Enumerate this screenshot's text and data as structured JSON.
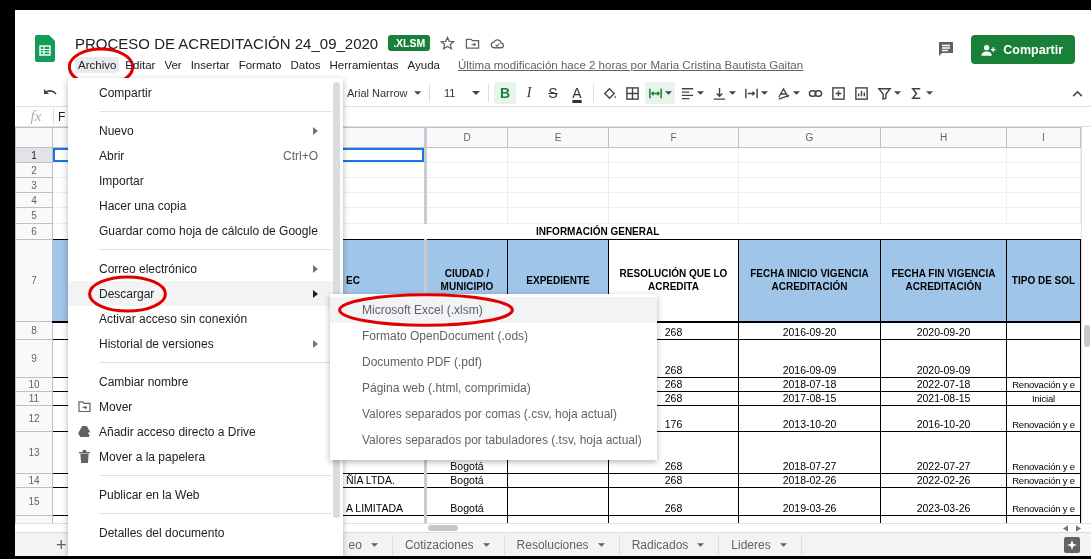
{
  "app": {
    "title": "PROCESO DE ACREDITACIÓN 24_09_2020",
    "badge": ".XLSM",
    "menus": [
      {
        "label": "Archivo",
        "selected": true,
        "circled": true
      },
      {
        "label": "Editar",
        "selected": false,
        "circled": false
      },
      {
        "label": "Ver",
        "selected": false,
        "circled": false
      },
      {
        "label": "Insertar",
        "selected": false,
        "circled": false
      },
      {
        "label": "Formato",
        "selected": false,
        "circled": false
      },
      {
        "label": "Datos",
        "selected": false,
        "circled": false
      },
      {
        "label": "Herramientas",
        "selected": false,
        "circled": false
      },
      {
        "label": "Ayuda",
        "selected": false,
        "circled": false
      }
    ],
    "last_edit": "Última modificación hace 2 horas por Maria Cristina Bautista Gaitan",
    "share_button": "Compartir"
  },
  "toolbar": {
    "font": "Arial Narrow",
    "font_size": "11",
    "format_buttons": [
      {
        "label": "B",
        "selected": true
      },
      {
        "label": "I",
        "selected": false
      },
      {
        "label": "S",
        "selected": false
      },
      {
        "label": "A",
        "selected": false
      }
    ],
    "tools": [
      {
        "kind": "fill",
        "selected": false,
        "dropdown": false
      },
      {
        "kind": "borders",
        "selected": false,
        "dropdown": false
      },
      {
        "kind": "merge",
        "selected": true,
        "dropdown": true
      },
      {
        "kind": "halign",
        "selected": false,
        "dropdown": true
      },
      {
        "kind": "valign",
        "selected": false,
        "dropdown": true
      },
      {
        "kind": "wrap",
        "selected": false,
        "dropdown": true
      },
      {
        "kind": "rotate",
        "selected": false,
        "dropdown": true
      },
      {
        "kind": "link",
        "selected": false,
        "dropdown": false
      },
      {
        "kind": "comment",
        "selected": false,
        "dropdown": false
      },
      {
        "kind": "chart",
        "selected": false,
        "dropdown": false
      },
      {
        "kind": "filter",
        "selected": false,
        "dropdown": true
      },
      {
        "kind": "functions",
        "selected": false,
        "dropdown": true
      }
    ]
  },
  "formula_bar": {
    "label": "fx",
    "value": "F"
  },
  "sheet": {
    "column_headers": [
      "D",
      "E",
      "F",
      "G",
      "H",
      "I"
    ],
    "rows": [
      {
        "number": "1",
        "kind": "blank",
        "selected": true
      },
      {
        "number": "2",
        "kind": "blank",
        "selected": false
      },
      {
        "number": "3",
        "kind": "blank",
        "selected": false
      },
      {
        "number": "4",
        "kind": "blank",
        "selected": false
      },
      {
        "number": "5",
        "kind": "blank",
        "selected": false
      },
      {
        "number": "6",
        "kind": "title",
        "selected": false,
        "title": "INFORMACIÓN GENERAL"
      },
      {
        "number": "7",
        "kind": "header",
        "selected": false,
        "cells": {
          "c": {
            "text": "EC",
            "color": "#9fc5e8"
          },
          "d": {
            "text": "CIUDAD / MUNICIPIO",
            "color": "#9fc5e8"
          },
          "e": {
            "text": "EXPEDIENTE",
            "color": "#9fc5e8"
          },
          "f": {
            "text": "RESOLUCIÓN QUE LO ACREDITA",
            "color": "#ffffff"
          },
          "g": {
            "text": "FECHA INICIO VIGENCIA ACREDITACIÓN",
            "color": "#9fc5e8"
          },
          "h": {
            "text": "FECHA FIN VIGENCIA ACREDITACIÓN",
            "color": "#9fc5e8"
          },
          "i": {
            "text": "TIPO DE SOL",
            "color": "#9fc5e8"
          }
        }
      },
      {
        "number": "8",
        "kind": "data",
        "selected": false,
        "cells": {
          "f": "268",
          "g": "2016-09-20",
          "h": "2020-09-20"
        }
      },
      {
        "number": "9",
        "kind": "data",
        "selected": false,
        "cells": {
          "f": "268",
          "g": "2016-09-09",
          "h": "2020-09-09"
        }
      },
      {
        "number": "10",
        "kind": "data",
        "selected": false,
        "cells": {
          "f": "268",
          "g": "2018-07-18",
          "h": "2022-07-18",
          "i": "Renovación y e"
        }
      },
      {
        "number": "11",
        "kind": "data",
        "selected": false,
        "cells": {
          "f": "268",
          "g": "2017-08-15",
          "h": "2021-08-15",
          "i": "Inicial"
        }
      },
      {
        "number": "12",
        "kind": "data",
        "selected": false,
        "cells": {
          "f": "176",
          "g": "2013-10-20",
          "h": "2016-10-20",
          "i": "Renovación y e"
        }
      },
      {
        "number": "13",
        "kind": "data",
        "selected": false,
        "cells": {
          "d": "Bogotá",
          "f": "268",
          "g": "2018-07-27",
          "h": "2022-07-27",
          "i": "Renovación y e"
        }
      },
      {
        "number": "14",
        "kind": "data",
        "selected": false,
        "cells": {
          "c": "ÑÍA LTDA.",
          "d": "Bogotá",
          "f": "268",
          "g": "2018-02-26",
          "h": "2022-02-26",
          "i": "Renovación y e"
        }
      },
      {
        "number": "15",
        "kind": "data",
        "selected": false,
        "cells": {
          "c": "A LIMITADA",
          "d": "Bogotá",
          "f": "268",
          "g": "2019-03-26",
          "h": "2023-03-26",
          "i": "Renovación y e"
        }
      },
      {
        "kind": "data",
        "selected": false
      }
    ]
  },
  "add_sheet": "+",
  "sheet_tabs": [
    {
      "label": "eo",
      "selected": false
    },
    {
      "label": "Cotizaciones",
      "selected": false
    },
    {
      "label": "Resoluciones",
      "selected": false
    },
    {
      "label": "Radicados",
      "selected": false
    },
    {
      "label": "Lideres",
      "selected": false
    }
  ],
  "file_menu": {
    "items": [
      {
        "kind": "item",
        "label": "Compartir",
        "submenu": false,
        "selected": false,
        "circled": false
      },
      {
        "kind": "divider"
      },
      {
        "kind": "item",
        "label": "Nuevo",
        "submenu": true,
        "selected": false,
        "circled": false
      },
      {
        "kind": "item",
        "label": "Abrir",
        "shortcut": "Ctrl+O",
        "submenu": false,
        "selected": false,
        "circled": false
      },
      {
        "kind": "item",
        "label": "Importar",
        "submenu": false,
        "selected": false,
        "circled": false
      },
      {
        "kind": "item",
        "label": "Hacer una copia",
        "submenu": false,
        "selected": false,
        "circled": false
      },
      {
        "kind": "item",
        "label": "Guardar como hoja de cálculo de Google",
        "submenu": false,
        "selected": false,
        "circled": false
      },
      {
        "kind": "divider"
      },
      {
        "kind": "item",
        "label": "Correo electrónico",
        "submenu": true,
        "selected": false,
        "circled": false
      },
      {
        "kind": "item",
        "label": "Descargar",
        "submenu": true,
        "selected": true,
        "circled": true
      },
      {
        "kind": "item",
        "label": "Activar acceso sin conexión",
        "submenu": false,
        "selected": false,
        "circled": false
      },
      {
        "kind": "item",
        "label": "Historial de versiones",
        "submenu": true,
        "selected": false,
        "circled": false
      },
      {
        "kind": "divider"
      },
      {
        "kind": "item",
        "label": "Cambiar nombre",
        "submenu": false,
        "selected": false,
        "circled": false
      },
      {
        "kind": "item",
        "label": "Mover",
        "submenu": false,
        "selected": false,
        "circled": false
      },
      {
        "kind": "item",
        "label": "Añadir acceso directo a Drive",
        "submenu": false,
        "selected": false,
        "circled": false
      },
      {
        "kind": "item",
        "label": "Mover a la papelera",
        "submenu": false,
        "selected": false,
        "circled": false
      },
      {
        "kind": "divider"
      },
      {
        "kind": "item",
        "label": "Publicar en la Web",
        "submenu": false,
        "selected": false,
        "circled": false
      },
      {
        "kind": "divider"
      },
      {
        "kind": "item",
        "label": "Detalles del documento",
        "submenu": false,
        "selected": false,
        "circled": false
      }
    ]
  },
  "download_menu": {
    "items": [
      {
        "label": "Microsoft Excel (.xlsm)",
        "selected": true,
        "circled": true
      },
      {
        "label": "Formato OpenDocument (.ods)",
        "selected": false,
        "circled": false
      },
      {
        "label": "Documento PDF (.pdf)",
        "selected": false,
        "circled": false
      },
      {
        "label": "Página web (.html, comprimida)",
        "selected": false,
        "circled": false
      },
      {
        "label": "Valores separados por comas (.csv, hoja actual)",
        "selected": false,
        "circled": false
      },
      {
        "label": "Valores separados por tabuladores (.tsv, hoja actual)",
        "selected": false,
        "circled": false
      }
    ]
  }
}
